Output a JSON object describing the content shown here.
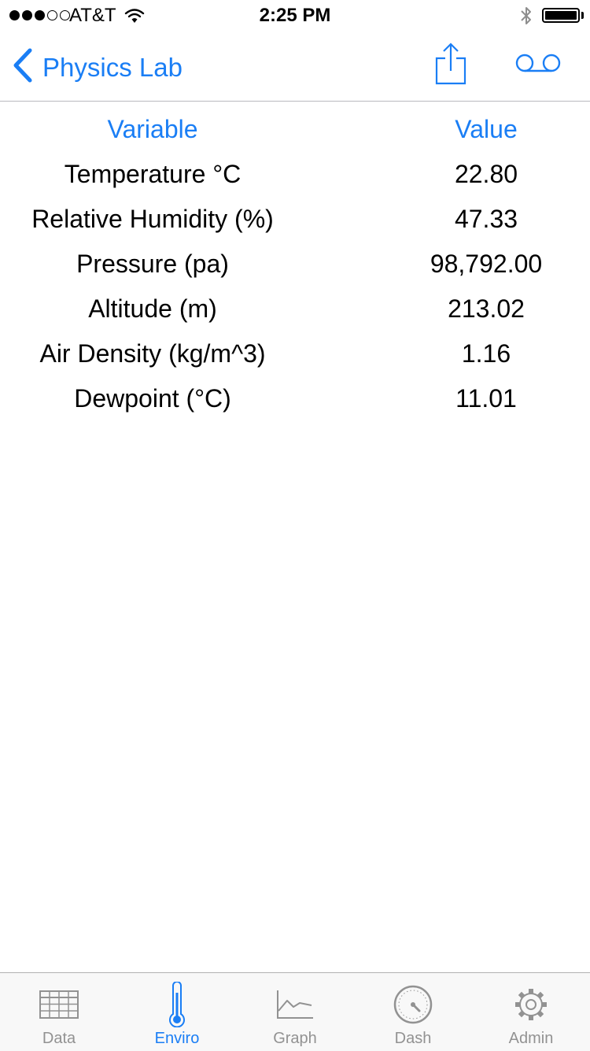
{
  "status_bar": {
    "signal_bars_filled": 3,
    "signal_bars_total": 5,
    "carrier": "AT&T",
    "time": "2:25 PM"
  },
  "nav": {
    "back_label": "Physics Lab",
    "accent_color": "#1a7ef5",
    "icons": [
      "chevron-left-icon",
      "share-icon",
      "record-icon"
    ]
  },
  "table": {
    "headers": {
      "variable": "Variable",
      "value": "Value"
    },
    "rows": [
      {
        "variable": "Temperature °C",
        "value": "22.80"
      },
      {
        "variable": "Relative Humidity (%)",
        "value": "47.33"
      },
      {
        "variable": "Pressure (pa)",
        "value": "98,792.00"
      },
      {
        "variable": "Altitude (m)",
        "value": "213.02"
      },
      {
        "variable": "Air Density (kg/m^3)",
        "value": "1.16"
      },
      {
        "variable": "Dewpoint (°C)",
        "value": "11.01"
      }
    ]
  },
  "tab_bar": {
    "active": "Enviro",
    "inactive_color": "#929292",
    "tabs": [
      {
        "label": "Data",
        "icon": "table-grid-icon"
      },
      {
        "label": "Enviro",
        "icon": "thermometer-icon"
      },
      {
        "label": "Graph",
        "icon": "line-graph-icon"
      },
      {
        "label": "Dash",
        "icon": "gauge-icon"
      },
      {
        "label": "Admin",
        "icon": "gear-icon"
      }
    ]
  }
}
